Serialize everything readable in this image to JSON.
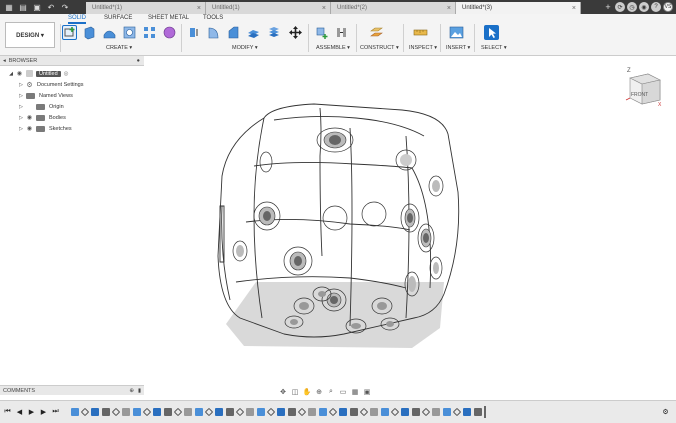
{
  "tabs": [
    {
      "label": "Untitled*(1)",
      "active": false
    },
    {
      "label": "Untitled(1)",
      "active": false
    },
    {
      "label": "Untitled*(2)",
      "active": false
    },
    {
      "label": "Untitled*(3)",
      "active": true
    }
  ],
  "workspace": {
    "label": "DESIGN ▾"
  },
  "toolbar_tabs": [
    "SOLID",
    "SURFACE",
    "SHEET METAL",
    "TOOLS"
  ],
  "groups": {
    "create": "CREATE ▾",
    "modify": "MODIFY ▾",
    "assemble": "ASSEMBLE ▾",
    "construct": "CONSTRUCT ▾",
    "inspect": "INSPECT ▾",
    "insert": "INSERT ▾",
    "select": "SELECT ▾"
  },
  "browser": {
    "title": "BROWSER",
    "root": "Untitled",
    "items": [
      "Document Settings",
      "Named Views",
      "Origin",
      "Bodies",
      "Sketches"
    ]
  },
  "comments": {
    "title": "COMMENTS"
  },
  "viewcube": {
    "face": "FRONT",
    "axis_z": "Z",
    "axis_x": "X"
  },
  "user": {
    "initials": "VS"
  },
  "colors": {
    "accent": "#1a70c8",
    "tabbar": "#3a3a3a",
    "toolbar": "#f4f4f4"
  }
}
